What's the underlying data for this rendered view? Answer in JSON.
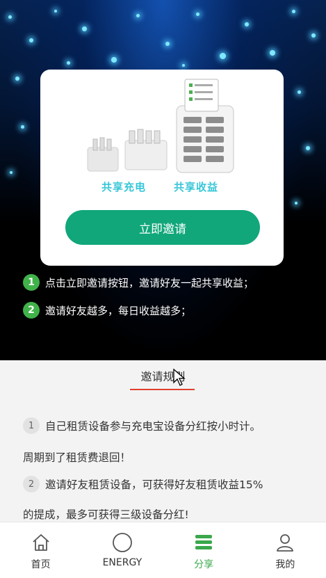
{
  "hero": {
    "product_tags": [
      "共享充电",
      "共享收益"
    ],
    "invite_button": "立即邀请",
    "steps": [
      {
        "num": "1",
        "text": "点击立即邀请按钮，邀请好友一起共享收益；"
      },
      {
        "num": "2",
        "text": "邀请好友越多，每日收益越多；"
      }
    ]
  },
  "rules": {
    "title": "邀请规则",
    "items": [
      {
        "num": "1",
        "line1": "自己租赁设备参与充电宝设备分红按小时计。",
        "line2": "周期到了租赁费退回！"
      },
      {
        "num": "2",
        "line1": "邀请好友租赁设备，可获得好友租赁收益15%",
        "line2": "的提成，最多可获得三级设备分红!"
      }
    ]
  },
  "tabbar": {
    "tabs": [
      {
        "label": "首页",
        "icon": "home-icon"
      },
      {
        "label": "ENERGY",
        "icon": "circle-icon"
      },
      {
        "label": "分享",
        "icon": "stack-icon"
      },
      {
        "label": "我的",
        "icon": "user-icon"
      }
    ],
    "active": "分享"
  },
  "colors": {
    "accent": "#11a77a",
    "active_tab": "#3aa84b",
    "tag": "#37c6d8",
    "underline": "#e0402c"
  }
}
